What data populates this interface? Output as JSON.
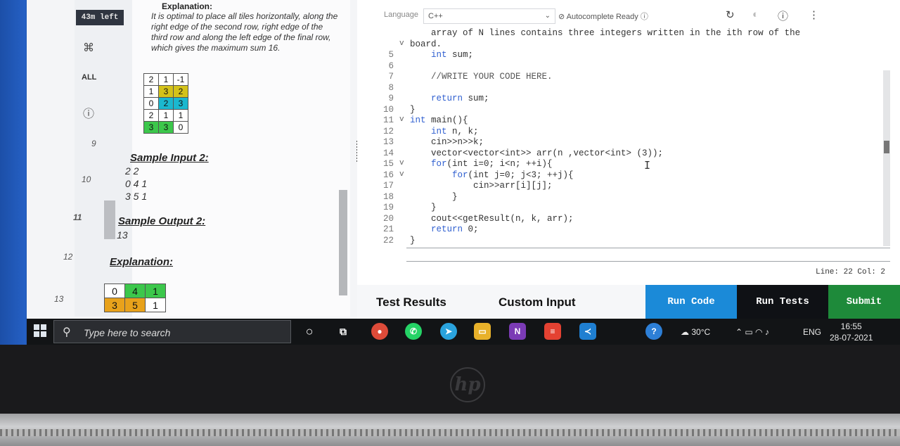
{
  "timer": "43m left",
  "nav": {
    "all_label": "ALL",
    "questions": [
      "9",
      "10",
      "11",
      "12",
      "13"
    ],
    "active_question": "11"
  },
  "problem": {
    "explanation_heading": "Explanation:",
    "explanation_text": "It is optimal to place all tiles horizontally, along the right edge of the second row, right edge of the third row and along the left edge of the final row, which gives the maximum sum 16.",
    "grid1": [
      [
        "2",
        "1",
        "-1"
      ],
      [
        "1",
        "3",
        "2"
      ],
      [
        "0",
        "2",
        "3"
      ],
      [
        "2",
        "1",
        "1"
      ],
      [
        "3",
        "3",
        "0"
      ]
    ],
    "grid1_colors": [
      [
        "#fff",
        "#fff",
        "#fff"
      ],
      [
        "#fff",
        "#d4c21a",
        "#d4c21a"
      ],
      [
        "#fff",
        "#1bb8cf",
        "#1bb8cf"
      ],
      [
        "#fff",
        "#fff",
        "#fff"
      ],
      [
        "#3cc74b",
        "#3cc74b",
        "#fff"
      ]
    ],
    "sample_input_label": "Sample Input 2:",
    "sample_input": "2 2\n0 4 1\n3 5 1",
    "sample_output_label": "Sample Output 2:",
    "sample_output": "13",
    "explanation2_label": "Explanation:",
    "grid2": [
      [
        "0",
        "4",
        "1"
      ],
      [
        "3",
        "5",
        "1"
      ]
    ],
    "grid2_colors": [
      [
        "#fff",
        "#3cc74b",
        "#3cc74b"
      ],
      [
        "#e8a21b",
        "#e8a21b",
        "#fff"
      ]
    ]
  },
  "editor": {
    "language_label": "Language",
    "language_value": "C++",
    "autocomplete": "Autocomplete Ready",
    "status": "Line: 22 Col: 2",
    "lines": [
      {
        "n": "",
        "fold": "",
        "text": "    array of N lines contains three integers written in the ith row of the"
      },
      {
        "n": "",
        "fold": "v",
        "text": "board."
      },
      {
        "n": "5",
        "fold": "",
        "text": "    int sum;"
      },
      {
        "n": "6",
        "fold": "",
        "text": ""
      },
      {
        "n": "7",
        "fold": "",
        "text": "    //WRITE YOUR CODE HERE."
      },
      {
        "n": "8",
        "fold": "",
        "text": ""
      },
      {
        "n": "9",
        "fold": "",
        "text": "    return sum;"
      },
      {
        "n": "10",
        "fold": "",
        "text": "}"
      },
      {
        "n": "11",
        "fold": "v",
        "text": "int main(){"
      },
      {
        "n": "12",
        "fold": "",
        "text": "    int n, k;"
      },
      {
        "n": "13",
        "fold": "",
        "text": "    cin>>n>>k;"
      },
      {
        "n": "14",
        "fold": "",
        "text": "    vector<vector<int>> arr(n ,vector<int> (3));"
      },
      {
        "n": "15",
        "fold": "v",
        "text": "    for(int i=0; i<n; ++i){"
      },
      {
        "n": "16",
        "fold": "v",
        "text": "        for(int j=0; j<3; ++j){"
      },
      {
        "n": "17",
        "fold": "",
        "text": "            cin>>arr[i][j];"
      },
      {
        "n": "18",
        "fold": "",
        "text": "        }"
      },
      {
        "n": "19",
        "fold": "",
        "text": "    }"
      },
      {
        "n": "20",
        "fold": "",
        "text": "    cout<<getResult(n, k, arr);"
      },
      {
        "n": "21",
        "fold": "",
        "text": "    return 0;"
      },
      {
        "n": "22",
        "fold": "",
        "text": "}"
      }
    ]
  },
  "tabs": {
    "test_results": "Test Results",
    "custom_input": "Custom Input"
  },
  "buttons": {
    "run_code": "Run Code",
    "run_tests": "Run Tests",
    "submit": "Submit"
  },
  "taskbar": {
    "search_placeholder": "Type here to search",
    "weather": "30°C",
    "lang": "ENG",
    "time": "16:55",
    "date": "28-07-2021"
  }
}
